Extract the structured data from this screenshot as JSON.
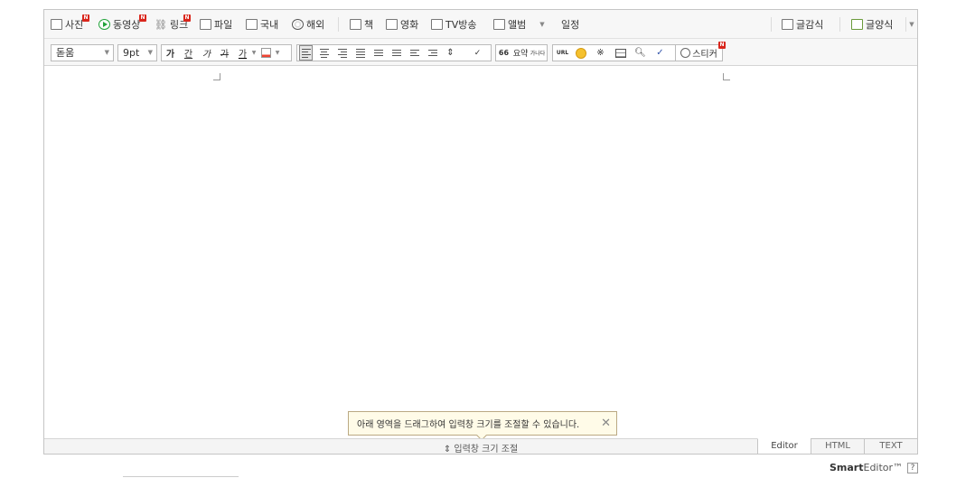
{
  "toolbar_top": {
    "items": [
      {
        "label": "사진",
        "icon": "photo-icon",
        "new": true
      },
      {
        "label": "동영상",
        "icon": "video-icon",
        "new": true
      },
      {
        "label": "링크",
        "icon": "link-icon",
        "new": true
      },
      {
        "label": "파일",
        "icon": "file-icon",
        "new": false
      },
      {
        "label": "국내",
        "icon": "map-icon",
        "new": false
      },
      {
        "label": "해외",
        "icon": "globe-icon",
        "new": false
      },
      {
        "label": "책",
        "icon": "book-icon",
        "new": false
      },
      {
        "label": "영화",
        "icon": "film-icon",
        "new": false
      },
      {
        "label": "TV방송",
        "icon": "tv-icon",
        "new": false
      },
      {
        "label": "앨범",
        "icon": "album-icon",
        "new": false
      },
      {
        "label": "일정",
        "icon": "",
        "new": false
      }
    ],
    "right": [
      {
        "label": "글감식",
        "icon": "pencil-icon"
      },
      {
        "label": "글양식",
        "icon": "template-icon"
      }
    ],
    "new_badge": "N"
  },
  "toolbar_format": {
    "font_family": "돋움",
    "font_size": "9pt",
    "bold": "가",
    "underline": "간",
    "italic": "가",
    "strike": "가",
    "text_color": "가",
    "quote": "66",
    "summary": "요약",
    "special": "가나다",
    "url": "URL",
    "sticker": "스티커"
  },
  "tooltip": {
    "text": "아래 영역을 드래그하여 입력창 크기를 조절할 수 있습니다.",
    "close": "✕"
  },
  "resize_bar": {
    "label": "⇕ 입력창 크기 조절"
  },
  "modes": [
    "Editor",
    "HTML",
    "TEXT"
  ],
  "active_mode": "Editor",
  "brand": {
    "bold": "Smart",
    "light": "Editor™",
    "help": "?"
  }
}
